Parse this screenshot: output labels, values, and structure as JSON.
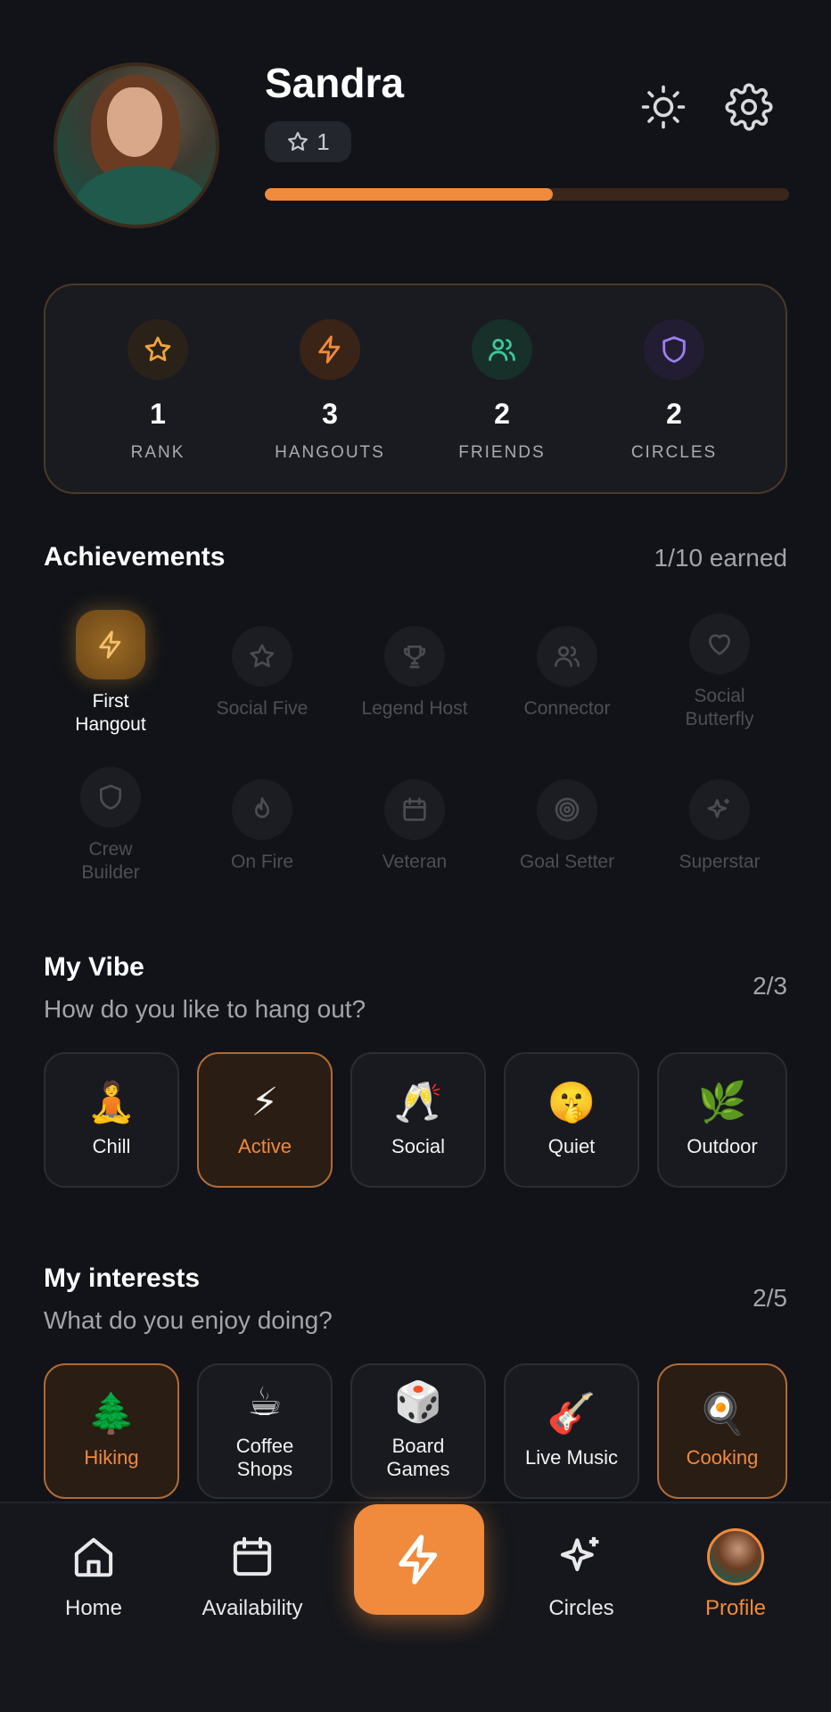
{
  "colors": {
    "accent": "#f08a3c",
    "background": "#111318",
    "card": "#191b20",
    "muted": "#a2a4aa"
  },
  "profile": {
    "name": "Sandra",
    "rank_value": "1",
    "level_progress": 0.55
  },
  "header": {
    "theme_icon": "sun-icon",
    "settings_icon": "gear-icon"
  },
  "stats": [
    {
      "value": "1",
      "label": "RANK",
      "icon": "star-icon",
      "color": "#f0a33c"
    },
    {
      "value": "3",
      "label": "HANGOUTS",
      "icon": "bolt-icon",
      "color": "#f08a3c"
    },
    {
      "value": "2",
      "label": "FRIENDS",
      "icon": "users-icon",
      "color": "#3fc79a"
    },
    {
      "value": "2",
      "label": "CIRCLES",
      "icon": "shield-icon",
      "color": "#9b7ff0"
    }
  ],
  "achievements": {
    "title": "Achievements",
    "count": "1/10 earned",
    "items": [
      {
        "name": "First\nHangout",
        "icon": "bolt-icon",
        "earned": true
      },
      {
        "name": "Social Five",
        "icon": "star-icon",
        "earned": false
      },
      {
        "name": "Legend Host",
        "icon": "trophy-icon",
        "earned": false
      },
      {
        "name": "Connector",
        "icon": "users-icon",
        "earned": false
      },
      {
        "name": "Social\nButterfly",
        "icon": "heart-icon",
        "earned": false
      },
      {
        "name": "Crew\nBuilder",
        "icon": "shield-icon",
        "earned": false
      },
      {
        "name": "On Fire",
        "icon": "flame-icon",
        "earned": false
      },
      {
        "name": "Veteran",
        "icon": "calendar-icon",
        "earned": false
      },
      {
        "name": "Goal Setter",
        "icon": "target-icon",
        "earned": false
      },
      {
        "name": "Superstar",
        "icon": "sparkle-icon",
        "earned": false
      }
    ]
  },
  "vibe": {
    "title": "My Vibe",
    "subtitle": "How do you like to hang out?",
    "count": "2/3",
    "items": [
      {
        "emoji": "🧘",
        "label": "Chill",
        "selected": false
      },
      {
        "emoji": "⚡",
        "label": "Active",
        "selected": true
      },
      {
        "emoji": "🥂",
        "label": "Social",
        "selected": false
      },
      {
        "emoji": "🤫",
        "label": "Quiet",
        "selected": false
      },
      {
        "emoji": "🌿",
        "label": "Outdoor",
        "selected": false
      }
    ]
  },
  "interests": {
    "title": "My interests",
    "subtitle": "What do you enjoy doing?",
    "count": "2/5",
    "items": [
      {
        "emoji": "🌲",
        "label": "Hiking",
        "selected": true
      },
      {
        "emoji": "☕",
        "label": "Coffee\nShops",
        "selected": false
      },
      {
        "emoji": "🎲",
        "label": "Board\nGames",
        "selected": false
      },
      {
        "emoji": "🎸",
        "label": "Live Music",
        "selected": false
      },
      {
        "emoji": "🍳",
        "label": "Cooking",
        "selected": true
      }
    ]
  },
  "nav": {
    "home": "Home",
    "availability": "Availability",
    "circles": "Circles",
    "profile": "Profile"
  }
}
